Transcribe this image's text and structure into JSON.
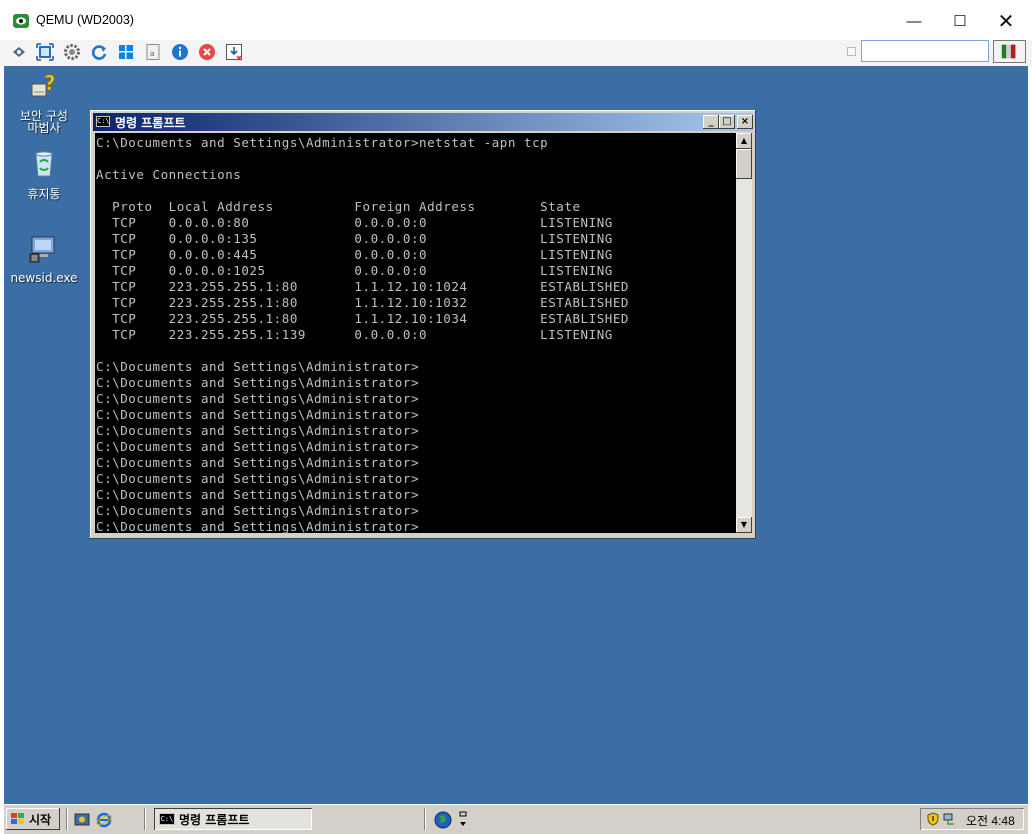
{
  "host": {
    "title": "QEMU (WD2003)",
    "window_buttons": {
      "minimize": "—",
      "maximize": "☐",
      "close": "✕"
    },
    "toolbar_icons": [
      "usb-icon",
      "fullscreen-icon",
      "gear-icon",
      "refresh-icon",
      "windows-icon",
      "drive-icon",
      "info-icon",
      "stop-icon",
      "screenshot-icon"
    ]
  },
  "desktop": {
    "background": "#3a6ea5",
    "icons": [
      {
        "name": "security-wizard",
        "label_line1": "보안 구성",
        "label_line2": "마법사"
      },
      {
        "name": "recycle-bin",
        "label_line1": "휴지통",
        "label_line2": ""
      },
      {
        "name": "newsid",
        "label_line1": "newsid.exe",
        "label_line2": ""
      }
    ]
  },
  "cmd": {
    "title": "명령 프롬프트",
    "icon_text": "C:\\",
    "lines": [
      "C:\\Documents and Settings\\Administrator>netstat -apn tcp",
      "",
      "Active Connections",
      "",
      "  Proto  Local Address          Foreign Address        State",
      "  TCP    0.0.0.0:80             0.0.0.0:0              LISTENING",
      "  TCP    0.0.0.0:135            0.0.0.0:0              LISTENING",
      "  TCP    0.0.0.0:445            0.0.0.0:0              LISTENING",
      "  TCP    0.0.0.0:1025           0.0.0.0:0              LISTENING",
      "  TCP    223.255.255.1:80       1.1.12.10:1024         ESTABLISHED",
      "  TCP    223.255.255.1:80       1.1.12.10:1032         ESTABLISHED",
      "  TCP    223.255.255.1:80       1.1.12.10:1034         ESTABLISHED",
      "  TCP    223.255.255.1:139      0.0.0.0:0              LISTENING",
      "",
      "C:\\Documents and Settings\\Administrator>",
      "C:\\Documents and Settings\\Administrator>",
      "C:\\Documents and Settings\\Administrator>",
      "C:\\Documents and Settings\\Administrator>",
      "C:\\Documents and Settings\\Administrator>",
      "C:\\Documents and Settings\\Administrator>",
      "C:\\Documents and Settings\\Administrator>",
      "C:\\Documents and Settings\\Administrator>",
      "C:\\Documents and Settings\\Administrator>",
      "C:\\Documents and Settings\\Administrator>",
      "C:\\Documents and Settings\\Administrator>"
    ]
  },
  "taskbar": {
    "start_label": "시작",
    "task_label": "명령 프롬프트",
    "clock": "오전 4:48"
  }
}
